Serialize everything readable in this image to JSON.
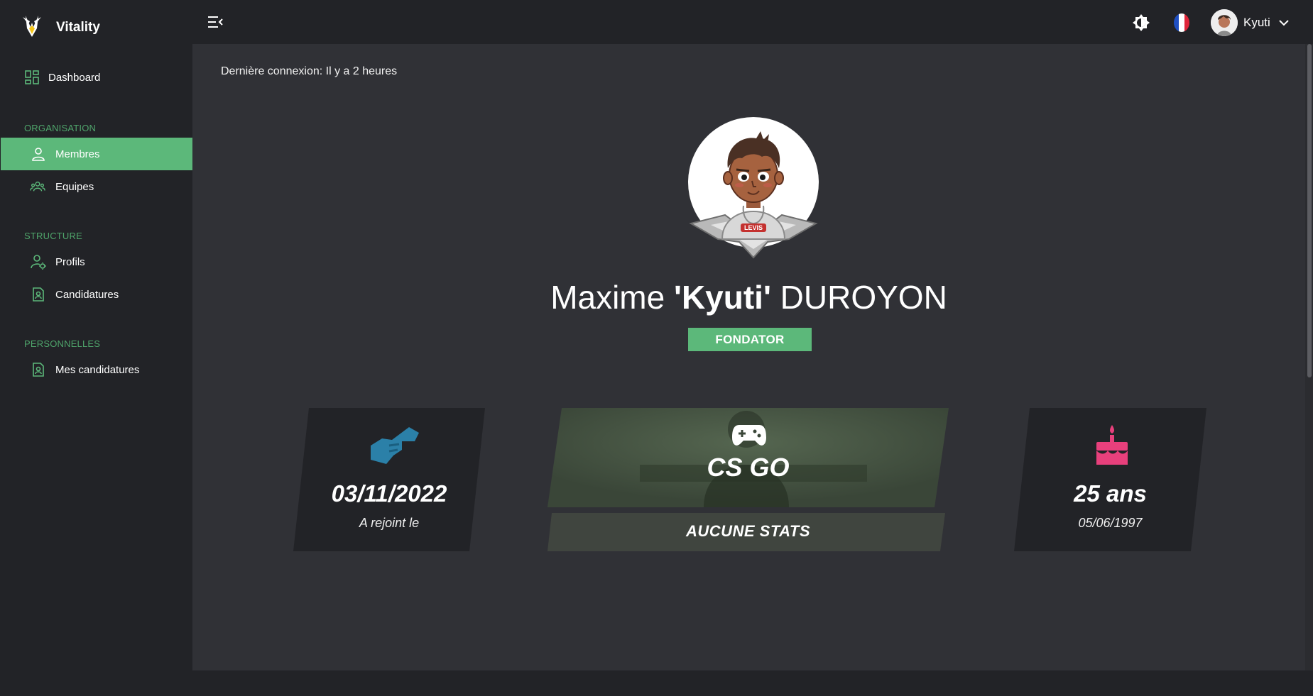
{
  "app": {
    "name": "Vitality",
    "colors": {
      "accent": "#5cb87a",
      "background": "#222327",
      "content": "#303136",
      "card": "#222327",
      "join_icon": "#2b80a8",
      "cake_icon": "#e8407c"
    }
  },
  "sidebar": {
    "dashboard": {
      "label": "Dashboard",
      "icon": "dashboard-icon"
    },
    "sections": [
      {
        "title": "ORGANISATION",
        "items": [
          {
            "label": "Membres",
            "icon": "user-icon",
            "active": true
          },
          {
            "label": "Equipes",
            "icon": "team-icon",
            "active": false
          }
        ]
      },
      {
        "title": "STRUCTURE",
        "items": [
          {
            "label": "Profils",
            "icon": "user-gear-icon",
            "active": false
          },
          {
            "label": "Candidatures",
            "icon": "document-user-icon",
            "active": false
          }
        ]
      },
      {
        "title": "PERSONNELLES",
        "items": [
          {
            "label": "Mes candidatures",
            "icon": "document-user-icon",
            "active": false
          }
        ]
      }
    ]
  },
  "topbar": {
    "user_name": "Kyuti",
    "icons": [
      "menu-collapse-icon",
      "theme-toggle-icon",
      "flag-fr-icon",
      "chevron-down-icon"
    ]
  },
  "profile": {
    "last_login": "Dernière connexion: Il y a 2 heures",
    "first_name": "Maxime",
    "nickname": "'Kyuti'",
    "last_name": "DUROYON",
    "role": "FONDATOR"
  },
  "cards": {
    "joined": {
      "value": "03/11/2022",
      "caption": "A rejoint le",
      "icon": "handshake-icon"
    },
    "game": {
      "title": "CS GO",
      "stats": "AUCUNE STATS",
      "icon": "gamepad-icon"
    },
    "age": {
      "value": "25 ans",
      "caption": "05/06/1997",
      "icon": "birthday-cake-icon"
    }
  }
}
